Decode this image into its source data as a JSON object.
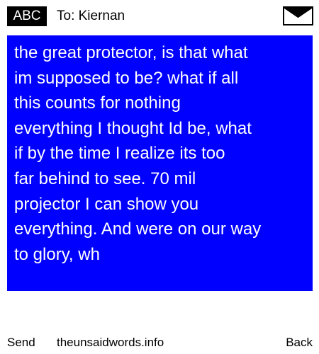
{
  "header": {
    "mode_label": "ABC",
    "recipient": "To: Kiernan",
    "icon": "envelope-icon"
  },
  "message": {
    "text": "the great protector, is that what\nim supposed to be? what if all\nthis counts for nothing\neverything I thought Id be, what\nif by the time I realize its too\nfar behind to see. 70 mil\nprojector I can show you\neverything. And were on our way\nto glory, wh"
  },
  "footer": {
    "left_softkey": "Send",
    "site": "theunsaidwords.info",
    "right_softkey": "Back"
  },
  "colors": {
    "message_background": "#0000ff",
    "message_text": "#ffffff",
    "badge_background": "#000000"
  }
}
